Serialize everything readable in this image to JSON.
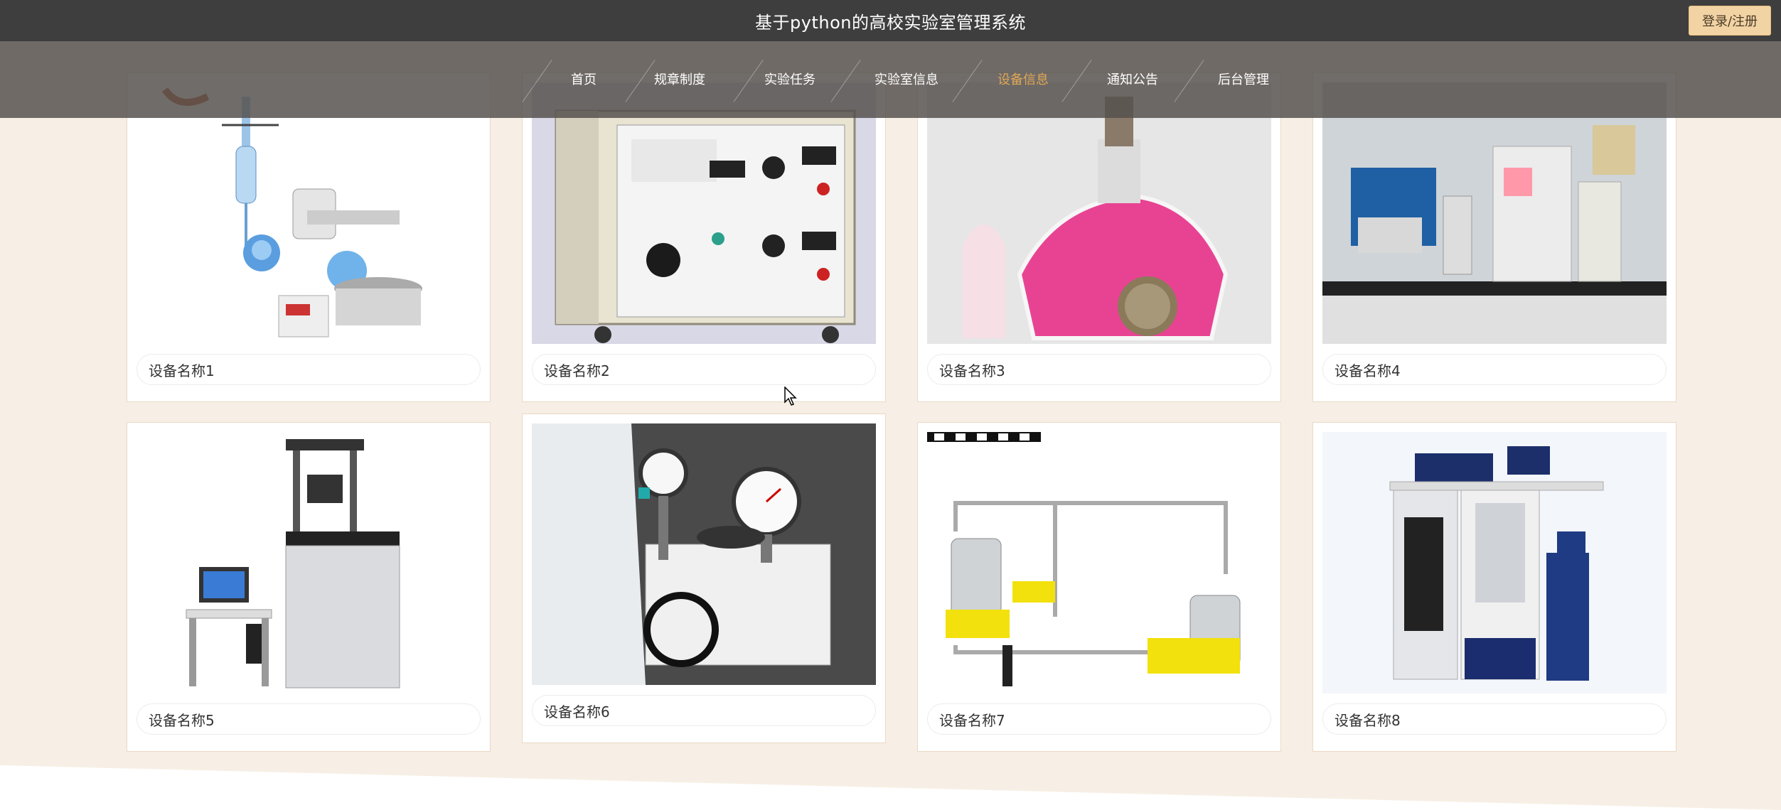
{
  "header": {
    "site_title": "基于python的高校实验室管理系统",
    "login_label": "登录/注册"
  },
  "nav": {
    "items": [
      {
        "label": "首页",
        "active": false
      },
      {
        "label": "规章制度",
        "active": false
      },
      {
        "label": "实验任务",
        "active": false
      },
      {
        "label": "实验室信息",
        "active": false
      },
      {
        "label": "设备信息",
        "active": true
      },
      {
        "label": "通知公告",
        "active": false
      },
      {
        "label": "后台管理",
        "active": false
      }
    ],
    "active_color": "#e0a655"
  },
  "equipment": [
    {
      "name": "设备名称1",
      "image": "rotary-evaporator"
    },
    {
      "name": "设备名称2",
      "image": "electrical-test-cabinet"
    },
    {
      "name": "设备名称3",
      "image": "alcohol-lamp-with-coin"
    },
    {
      "name": "设备名称4",
      "image": "lab-analyzer-bench"
    },
    {
      "name": "设备名称5",
      "image": "material-testing-machine"
    },
    {
      "name": "设备名称6",
      "image": "pressure-gauge-tester"
    },
    {
      "name": "设备名称7",
      "image": "heat-exchange-apparatus"
    },
    {
      "name": "设备名称8",
      "image": "analysis-instrument-cabinet"
    }
  ],
  "colors": {
    "page_bg": "#f7efe5",
    "topbar": "#3e3e3e",
    "login_button": "#f2d3a4"
  }
}
